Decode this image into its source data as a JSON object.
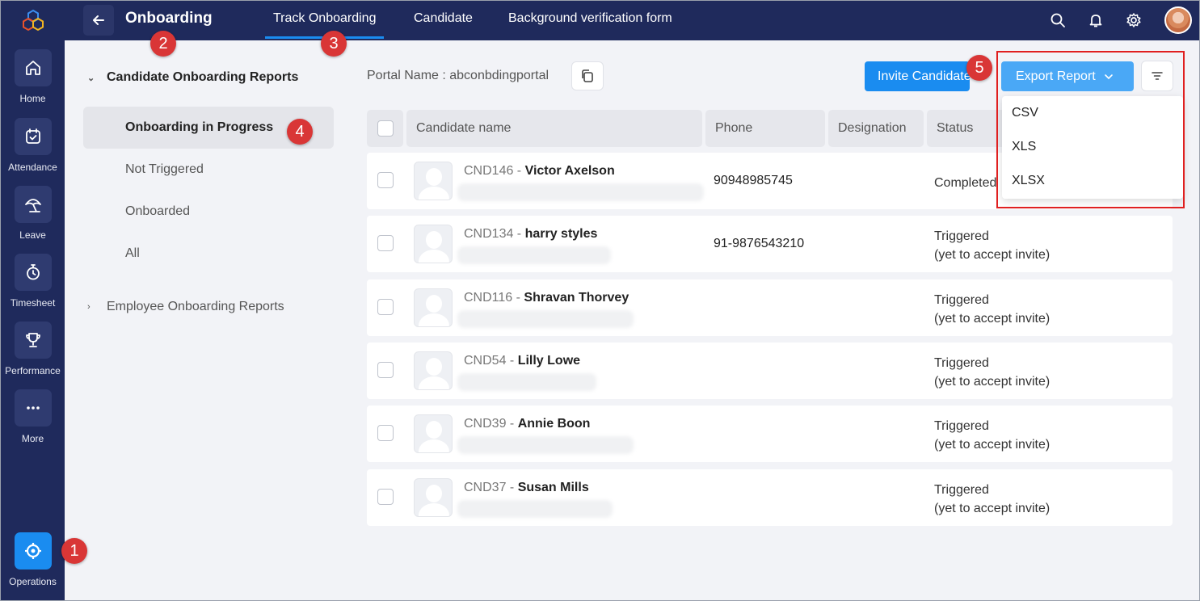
{
  "rail": {
    "items": [
      {
        "label": "Home",
        "icon": "home-icon"
      },
      {
        "label": "Attendance",
        "icon": "calendar-check-icon"
      },
      {
        "label": "Leave",
        "icon": "beach-umbrella-icon"
      },
      {
        "label": "Timesheet",
        "icon": "stopwatch-icon"
      },
      {
        "label": "Performance",
        "icon": "trophy-icon"
      },
      {
        "label": "More",
        "icon": "more-dots-icon"
      }
    ],
    "operations_label": "Operations"
  },
  "header": {
    "title": "Onboarding",
    "tabs": [
      {
        "label": "Track Onboarding",
        "active": true
      },
      {
        "label": "Candidate"
      },
      {
        "label": "Background verification form"
      }
    ]
  },
  "markers": [
    "1",
    "2",
    "3",
    "4",
    "5"
  ],
  "sidebar": {
    "group1": "Candidate Onboarding Reports",
    "items": [
      {
        "label": "Onboarding in Progress",
        "active": true
      },
      {
        "label": "Not Triggered"
      },
      {
        "label": "Onboarded"
      },
      {
        "label": "All"
      }
    ],
    "group2": "Employee Onboarding Reports"
  },
  "toolbar": {
    "portal_label": "Portal Name : abconbdingportal",
    "invite_label": "Invite Candidate",
    "export_label": "Export Report",
    "export_options": [
      "CSV",
      "XLS",
      "XLSX"
    ]
  },
  "table": {
    "headers": [
      "Candidate name",
      "Phone",
      "Designation",
      "Status"
    ],
    "rows": [
      {
        "id": "CND146",
        "name": "Victor Axelson",
        "phone": "90948985745",
        "status1": "Completed",
        "status2": ""
      },
      {
        "id": "CND134",
        "name": "harry styles",
        "phone": "91-9876543210",
        "status1": "Triggered",
        "status2": "(yet to accept invite)"
      },
      {
        "id": "CND116",
        "name": "Shravan Thorvey",
        "phone": "",
        "status1": "Triggered",
        "status2": "(yet to accept invite)"
      },
      {
        "id": "CND54",
        "name": "Lilly Lowe",
        "phone": "",
        "status1": "Triggered",
        "status2": "(yet to accept invite)"
      },
      {
        "id": "CND39",
        "name": "Annie Boon",
        "phone": "",
        "status1": "Triggered",
        "status2": "(yet to accept invite)"
      },
      {
        "id": "CND37",
        "name": "Susan Mills",
        "phone": "",
        "status1": "Triggered",
        "status2": "(yet to accept invite)"
      }
    ]
  },
  "colors": {
    "nav_bg": "#1f2a5c",
    "accent": "#1a8cf0",
    "marker": "#d93636",
    "highlight": "#e02020"
  }
}
